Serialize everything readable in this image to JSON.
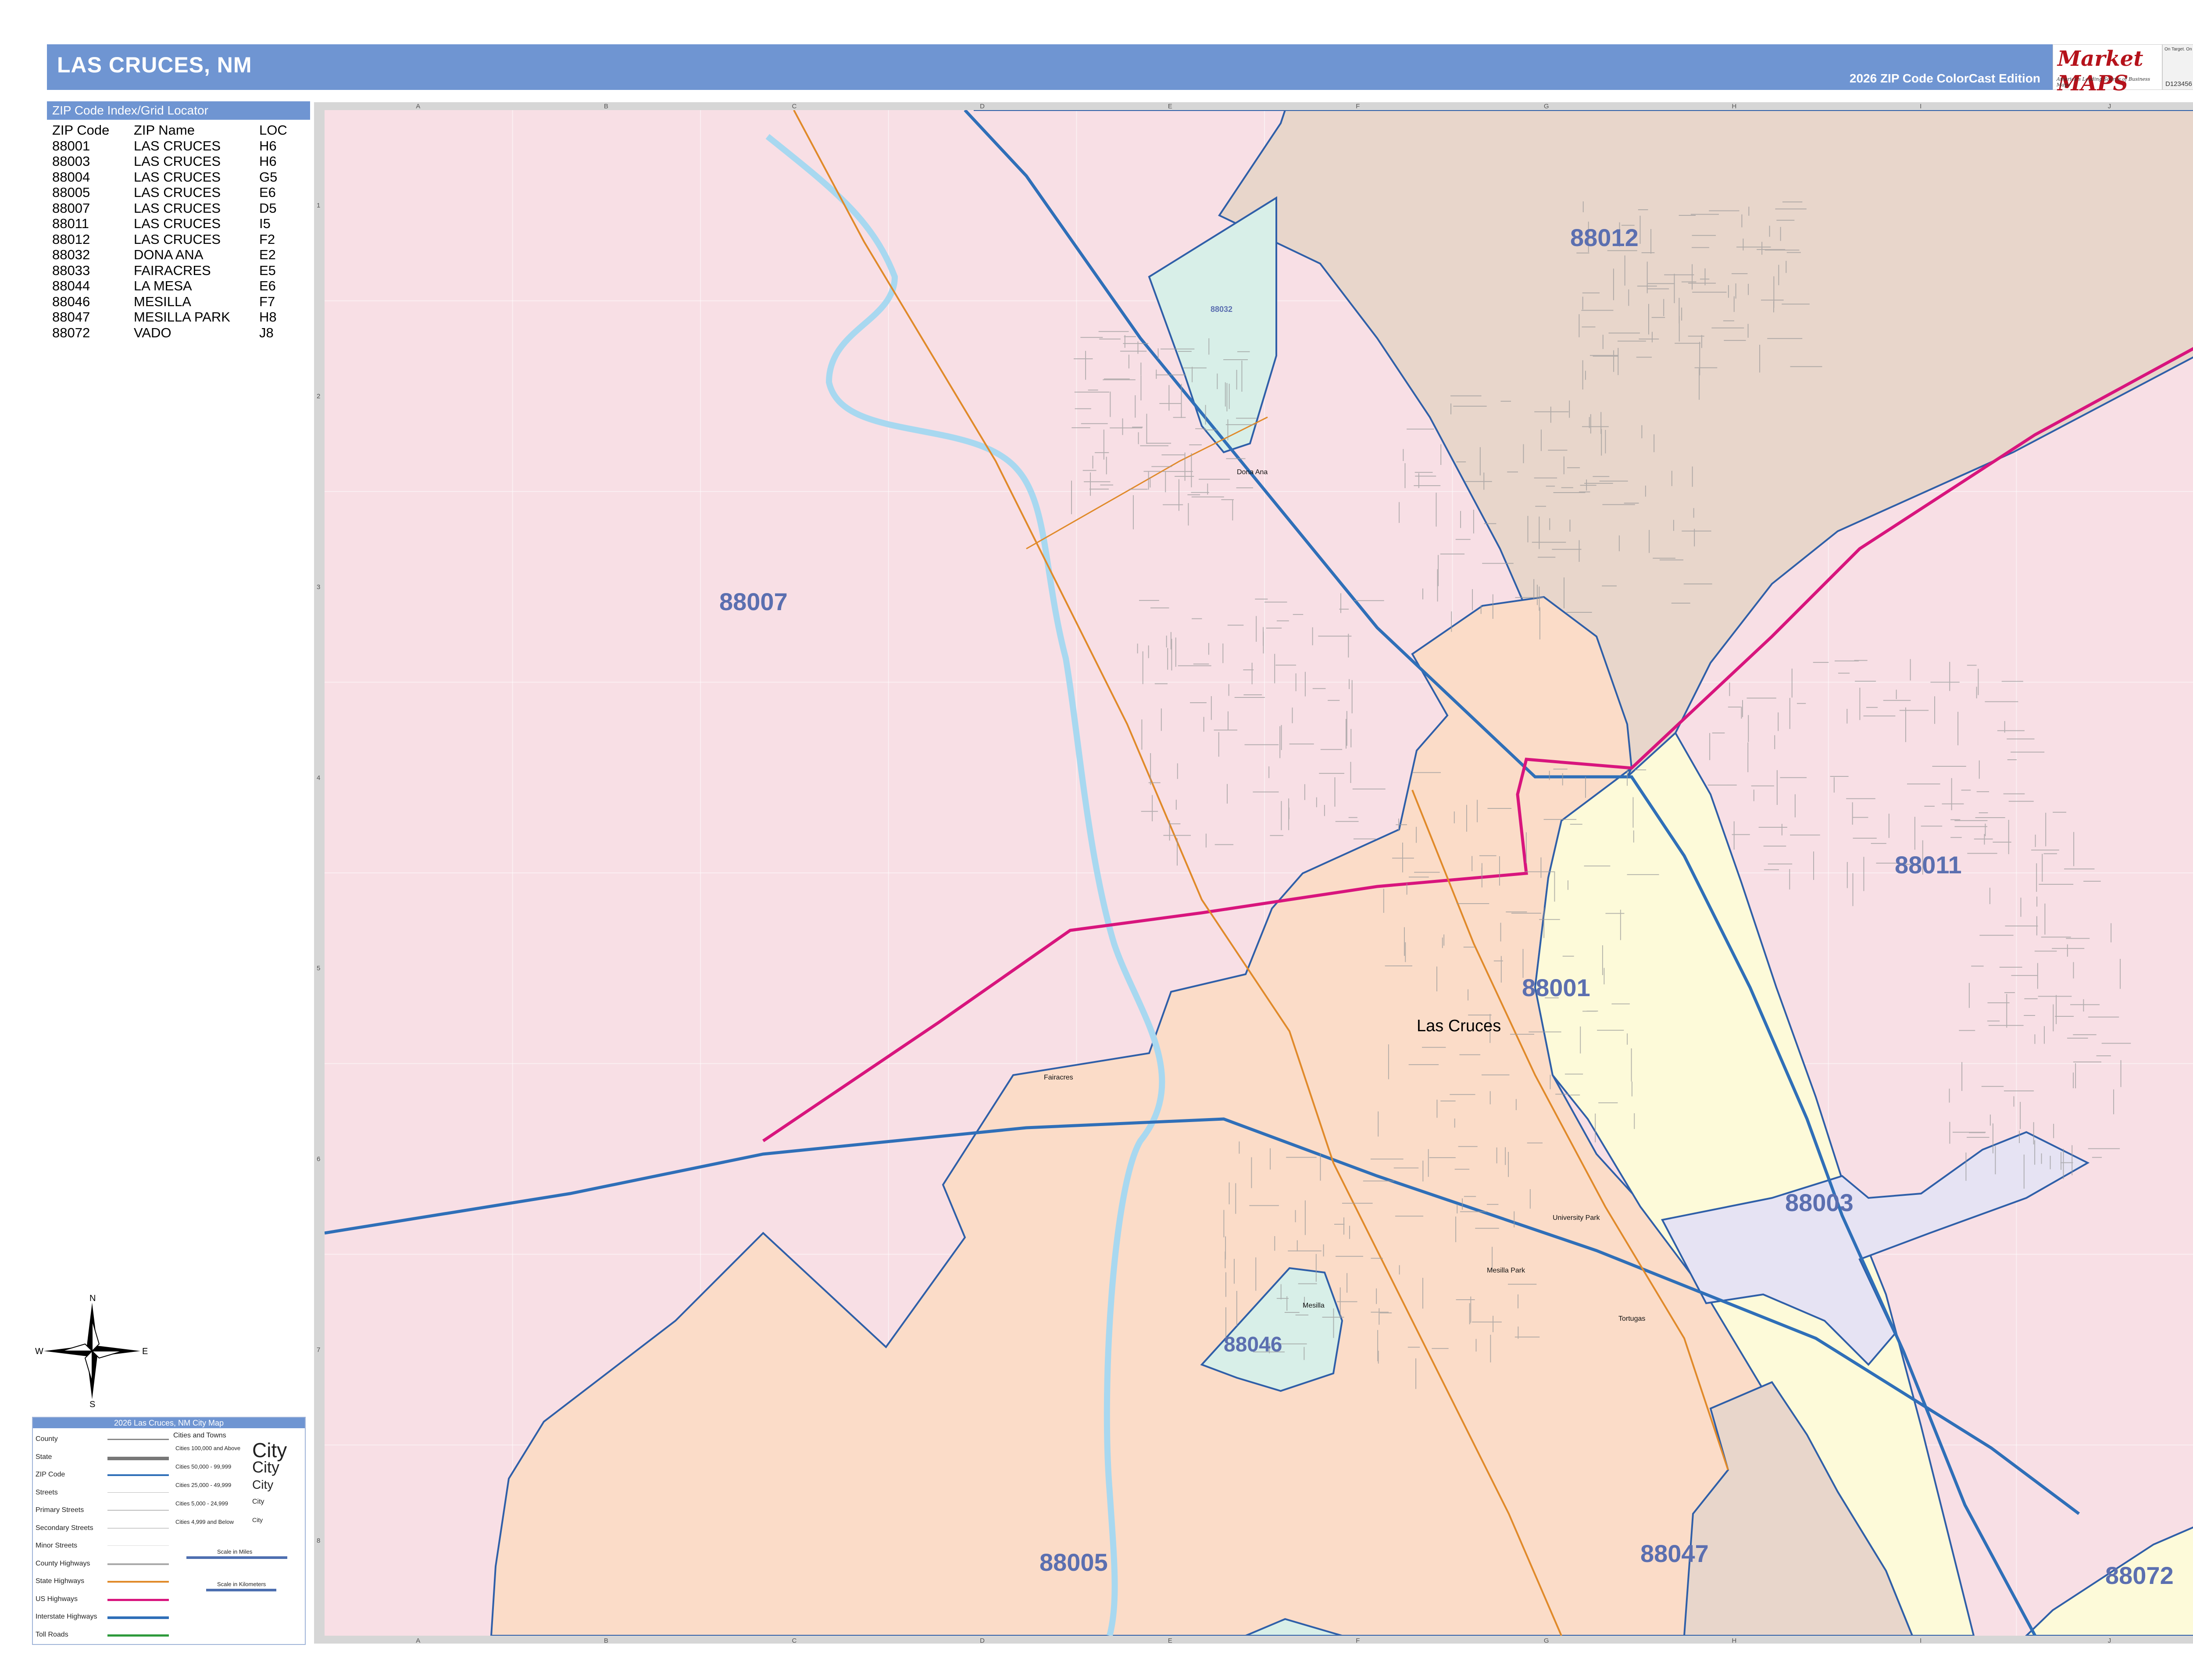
{
  "header": {
    "title": "LAS CRUCES, NM",
    "edition": "2026 ZIP Code ColorCast Edition",
    "logo_text": "Market MAPS",
    "logo_tagline": "On Target. On Time.",
    "logo_subtitle": "America's Leading Source of Business Maps",
    "product_code": "D123456"
  },
  "index": {
    "title": "ZIP Code Index/Grid Locator",
    "columns": [
      "ZIP Code",
      "ZIP Name",
      "LOC"
    ],
    "rows": [
      [
        "88001",
        "LAS CRUCES",
        "H6"
      ],
      [
        "88003",
        "LAS CRUCES",
        "H6"
      ],
      [
        "88004",
        "LAS CRUCES",
        "G5"
      ],
      [
        "88005",
        "LAS CRUCES",
        "E6"
      ],
      [
        "88007",
        "LAS CRUCES",
        "D5"
      ],
      [
        "88011",
        "LAS CRUCES",
        "I5"
      ],
      [
        "88012",
        "LAS CRUCES",
        "F2"
      ],
      [
        "88032",
        "DONA ANA",
        "E2"
      ],
      [
        "88033",
        "FAIRACRES",
        "E5"
      ],
      [
        "88044",
        "LA MESA",
        "E6"
      ],
      [
        "88046",
        "MESILLA",
        "F7"
      ],
      [
        "88047",
        "MESILLA PARK",
        "H8"
      ],
      [
        "88072",
        "VADO",
        "J8"
      ]
    ]
  },
  "map": {
    "grid_columns": [
      "A",
      "B",
      "C",
      "D",
      "E",
      "F",
      "G",
      "H",
      "I",
      "J"
    ],
    "grid_rows": [
      "1",
      "2",
      "3",
      "4",
      "5",
      "6",
      "7",
      "8"
    ],
    "zip_labels": {
      "z88012": "88012",
      "z88007": "88007",
      "z88011": "88011",
      "z88001": "88001",
      "z88003": "88003",
      "z88046": "88046",
      "z88005": "88005",
      "z88047": "88047",
      "z88072": "88072",
      "z88032": "88032"
    },
    "city_label": "Las Cruces",
    "place_labels": {
      "dona_ana": "Dona Ana",
      "fairacres": "Fairacres",
      "university_park": "University Park",
      "mesilla_park": "Mesilla Park",
      "mesilla": "Mesilla",
      "tortugas": "Tortugas"
    },
    "colors": {
      "pink": "#f8dfe5",
      "peach": "#fbdcc8",
      "tan": "#e8d6cb",
      "yellow": "#fdfad9",
      "lavender": "#e6e3f3",
      "teal": "#d8efe8",
      "boundary": "#2f5fa8",
      "river": "#a8d8f0",
      "us_highway": "#d8157d",
      "state_highway": "#e08a2a",
      "interstate": "#2f6fb8"
    }
  },
  "compass": {
    "n": "N",
    "s": "S",
    "e": "E",
    "w": "W"
  },
  "legend": {
    "title": "2026 Las Cruces, NM City Map",
    "left_items": [
      "County",
      "State",
      "ZIP Code",
      "Streets",
      "Primary Streets",
      "Secondary Streets",
      "Minor Streets",
      "County Highways",
      "State Highways",
      "US Highways",
      "Interstate Highways",
      "Toll Roads"
    ],
    "right_header": "Cities and Towns",
    "city_sizes": [
      "Cities 100,000 and Above",
      "Cities 50,000 - 99,999",
      "Cities 25,000 - 49,999",
      "Cities 5,000 - 24,999",
      "Cities 4,999 and Below"
    ],
    "city_samples": [
      "City",
      "City",
      "City",
      "City",
      "City"
    ],
    "scale_miles": "Scale in Miles",
    "scale_km": "Scale in Kilometers"
  }
}
